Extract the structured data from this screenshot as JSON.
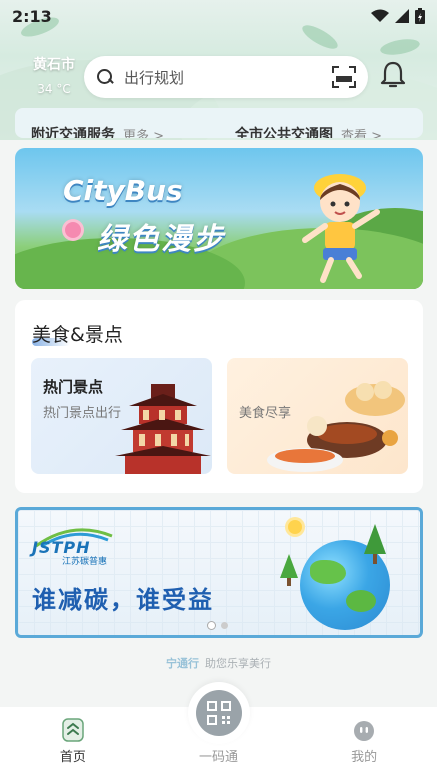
{
  "status_bar": {
    "time": "2:13"
  },
  "header": {
    "city": "黄石市",
    "temperature": "34 °C",
    "search_placeholder": "出行规划"
  },
  "services": [
    {
      "title": "附近交通服务",
      "more": "更多 >"
    },
    {
      "title": "全市公共交通图",
      "more": "查看 >"
    }
  ],
  "citybus_banner": {
    "title": "CityBus",
    "subtitle": "绿色漫步"
  },
  "food_section": {
    "title": "美食&景点",
    "tiles": [
      {
        "title": "热门景点",
        "subtitle": "热门景点出行"
      },
      {
        "title": "",
        "subtitle": "美食尽享"
      }
    ]
  },
  "carbon_banner": {
    "logo_text": "JSTPH",
    "logo_sub": "江苏碳普惠",
    "slogan": "谁减碳，谁受益"
  },
  "footer": {
    "brand": "宁通行",
    "tagline": "助您乐享美行"
  },
  "bottom_nav": [
    {
      "label": "首页",
      "active": true
    },
    {
      "label": "一码通",
      "active": false
    },
    {
      "label": "我的",
      "active": false
    }
  ],
  "colors": {
    "accent": "#1f5fb0",
    "banner_border": "#5aa9d8",
    "nav_active": "#333333",
    "nav_inactive": "#999999"
  }
}
